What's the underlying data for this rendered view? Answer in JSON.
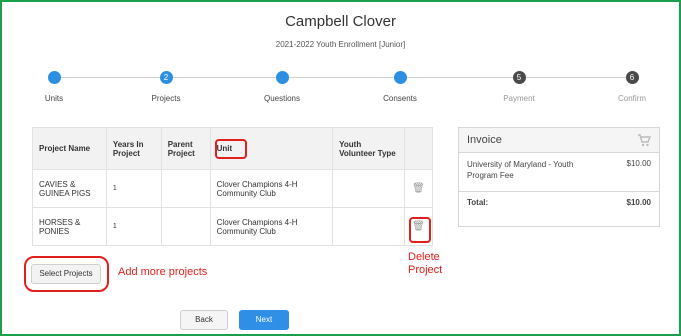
{
  "header": {
    "title": "Campbell Clover",
    "subtitle": "2021-2022 Youth Enrollment [Junior]"
  },
  "steps": [
    {
      "label": "Units",
      "number": "",
      "state": "done"
    },
    {
      "label": "Projects",
      "number": "2",
      "state": "current"
    },
    {
      "label": "Questions",
      "number": "",
      "state": "done"
    },
    {
      "label": "Consents",
      "number": "",
      "state": "done"
    },
    {
      "label": "Payment",
      "number": "5",
      "state": "upcoming"
    },
    {
      "label": "Confirm",
      "number": "6",
      "state": "upcoming"
    }
  ],
  "table": {
    "headers": [
      "Project Name",
      "Years In Project",
      "Parent Project",
      "Unit",
      "Youth Volunteer Type",
      ""
    ],
    "rows": [
      {
        "name": "CAVIES & GUINEA PIGS",
        "years": "1",
        "parent": "",
        "unit": "Clover Champions 4-H Community Club",
        "volunteer_type": ""
      },
      {
        "name": "HORSES & PONIES",
        "years": "1",
        "parent": "",
        "unit": "Clover Champions 4-H Community Club",
        "volunteer_type": ""
      }
    ]
  },
  "invoice": {
    "title": "Invoice",
    "item_desc": "University of Maryland - Youth Program Fee",
    "item_amount": "$10.00",
    "total_label": "Total:",
    "total_amount": "$10.00"
  },
  "buttons": {
    "select_projects": "Select Projects",
    "back": "Back",
    "next": "Next"
  },
  "annotations": {
    "add_more": "Add more projects",
    "delete_project": "Delete Project",
    "color": "#e0201b"
  },
  "colors": {
    "frame": "#1aa04a",
    "step_active": "#2d8fe0",
    "step_inactive": "#4a4a4a",
    "next_button": "#2f8fe6"
  },
  "icons": {
    "trash": "trash-icon",
    "cart": "cart-icon"
  }
}
